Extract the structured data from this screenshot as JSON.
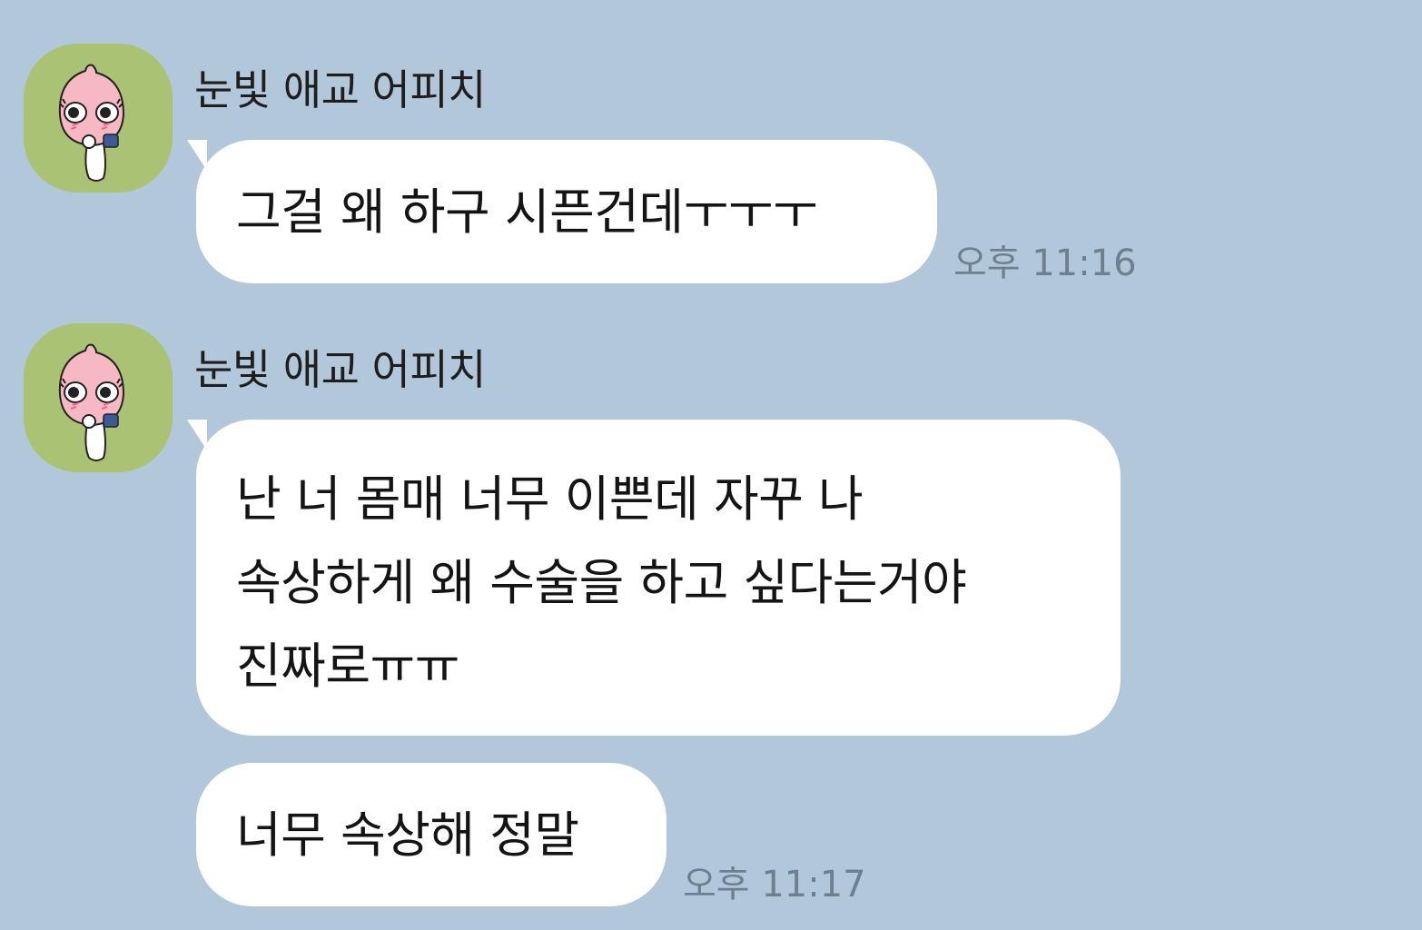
{
  "chat": {
    "background_color": "#b2c7da",
    "avatar_color": "#a9c273",
    "groups": [
      {
        "sender": "눈빛 애교 어피치",
        "avatar_icon": "apeach-avatar-icon",
        "messages": [
          {
            "lines": [
              "그걸 왜 하구 시픈건데ㅜㅜㅜ"
            ],
            "time": "오후 11:16"
          }
        ]
      },
      {
        "sender": "눈빛 애교 어피치",
        "avatar_icon": "apeach-avatar-icon",
        "messages": [
          {
            "lines": [
              "난 너 몸매 너무 이쁜데 자꾸 나",
              "속상하게 왜 수술을 하고 싶다는거야",
              "진짜로ㅠㅠ"
            ],
            "time": ""
          },
          {
            "lines": [
              "너무 속상해 정말"
            ],
            "time": "오후 11:17"
          }
        ]
      }
    ]
  }
}
